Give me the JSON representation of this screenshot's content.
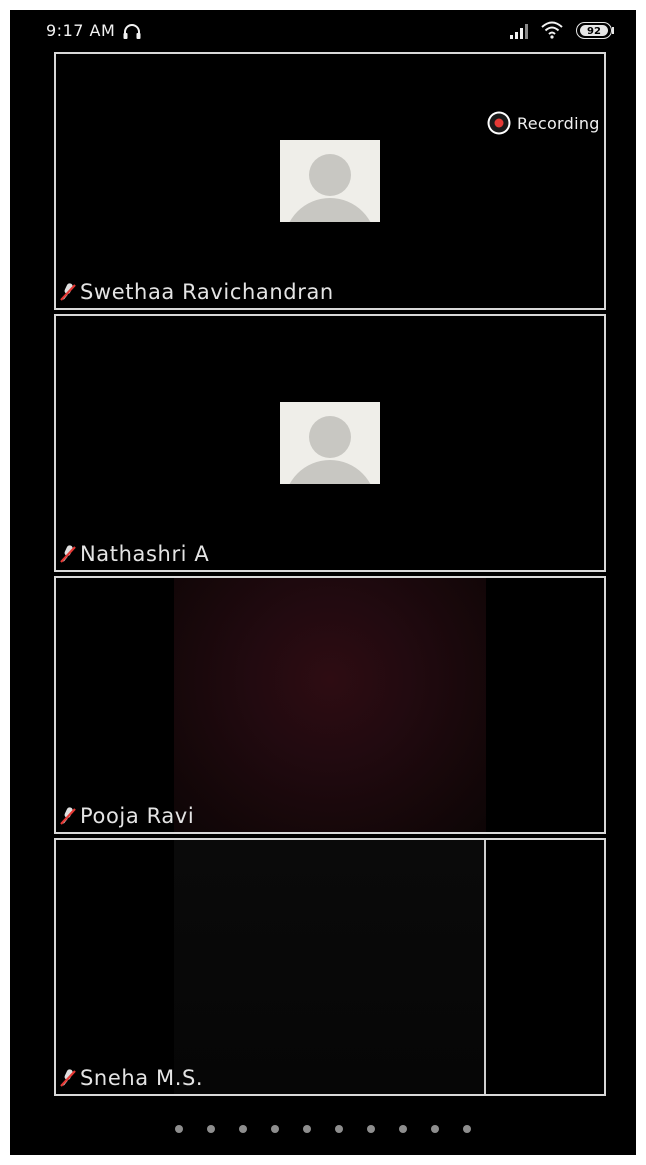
{
  "status_bar": {
    "time": "9:17 AM",
    "battery": "92",
    "icons": [
      "headset-icon",
      "signal-icon",
      "wifi-icon",
      "battery-icon"
    ]
  },
  "recording": {
    "label": "Recording",
    "icon": "record-icon",
    "color": "#e53935"
  },
  "participants": [
    {
      "name": "Swethaa Ravichandran",
      "video": "avatar",
      "mic": "muted"
    },
    {
      "name": "Nathashri A",
      "video": "avatar",
      "mic": "muted"
    },
    {
      "name": "Pooja Ravi",
      "video": "camera",
      "mic": "muted"
    },
    {
      "name": "Sneha M.S.",
      "video": "camera",
      "mic": "muted"
    }
  ],
  "pagination": {
    "page_count": 10
  },
  "colors": {
    "background": "#000000",
    "tile_border": "#d9d9d9",
    "avatar_bg": "#efeee9",
    "avatar_fg": "#c8c7c2",
    "muted_mic": "#e53935"
  }
}
